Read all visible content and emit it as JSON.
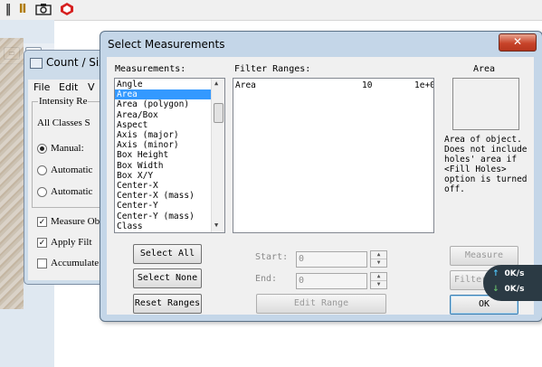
{
  "toolbar": {
    "icons": [
      "ruler-icon",
      "bar-icon",
      "camera-icon",
      "cube-icon"
    ],
    "icon_glyphs": [
      "‖",
      "Ⅱ",
      "📷",
      "⬣"
    ]
  },
  "background_window": {
    "buttons": [
      "▭",
      "✕"
    ]
  },
  "count_window": {
    "title": "Count / Siz",
    "menu": [
      "File",
      "Edit",
      "V"
    ],
    "intensity_group": "Intensity Re",
    "all_classes": "All Classes S",
    "manual": "Manual:",
    "automatic_1": "Automatic",
    "automatic_2": "Automatic",
    "measure_obj": "Measure Ob",
    "apply_filter": "Apply Filt",
    "accumulate": "Accumulate"
  },
  "dialog": {
    "title": "Select Measurements",
    "close_glyph": "✕",
    "measurements_label": "Measurements:",
    "filter_ranges_label": "Filter Ranges:",
    "preview_title": "Area",
    "measurements": [
      "Angle",
      "Area",
      "Area (polygon)",
      "Area/Box",
      "Aspect",
      "Axis (major)",
      "Axis (minor)",
      "Box Height",
      "Box Width",
      "Box X/Y",
      "Center-X",
      "Center-X (mass)",
      "Center-Y",
      "Center-Y (mass)",
      "Class"
    ],
    "selected_index": 1,
    "filter_rows": [
      {
        "name": "Area",
        "min": "10",
        "max": "1e+0"
      }
    ],
    "description": "Area of object. Does not include holes' area if <Fill Holes> option is turned off.",
    "buttons": {
      "select_all": "Select All",
      "select_none": "Select None",
      "reset_ranges": "Reset Ranges",
      "edit_range": "Edit Range",
      "measure": "Measure",
      "filter": "Filter",
      "ok": "OK"
    },
    "start_label": "Start:",
    "end_label": "End:",
    "start_value": "0",
    "end_value": "0"
  },
  "speed_widget": {
    "up": "0K/s",
    "down": "0K/s"
  }
}
